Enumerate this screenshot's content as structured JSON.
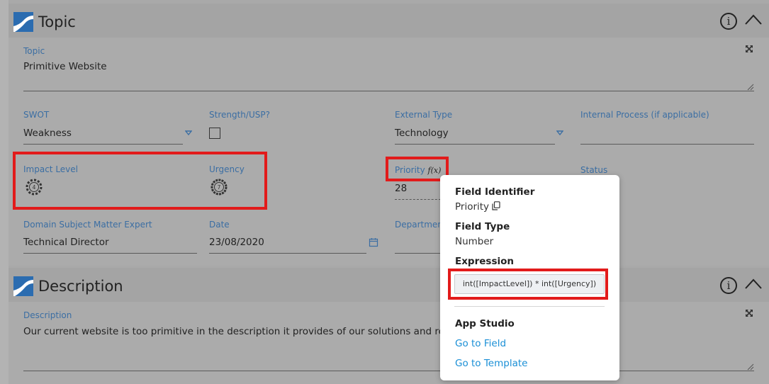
{
  "topic_section": {
    "title": "Topic",
    "fields": {
      "topic": {
        "label": "Topic",
        "value": "Primitive Website"
      },
      "swot": {
        "label": "SWOT",
        "value": "Weakness"
      },
      "strength": {
        "label": "Strength/USP?",
        "checked": false
      },
      "external_type": {
        "label": "External Type",
        "value": "Technology"
      },
      "internal_process": {
        "label": "Internal Process (if applicable)",
        "value": ""
      },
      "impact_level": {
        "label": "Impact Level",
        "value": "4"
      },
      "urgency": {
        "label": "Urgency",
        "value": "7"
      },
      "priority": {
        "label": "Priority",
        "formula_icon": "f(x)",
        "value": "28"
      },
      "status": {
        "label": "Status"
      },
      "domain_expert": {
        "label": "Domain Subject Matter Expert",
        "value": "Technical Director"
      },
      "date": {
        "label": "Date",
        "value": "23/08/2020"
      },
      "department": {
        "label": "Department"
      }
    }
  },
  "description_section": {
    "title": "Description",
    "fields": {
      "description": {
        "label": "Description",
        "value": "Our current website is too primitive in the description it provides of our solutions and requ"
      }
    }
  },
  "popup": {
    "field_identifier_heading": "Field Identifier",
    "field_identifier_value": "Priority",
    "field_type_heading": "Field Type",
    "field_type_value": "Number",
    "expression_heading": "Expression",
    "expression_value": "int([ImpactLevel]) * int([Urgency])",
    "app_studio_heading": "App Studio",
    "go_to_field": "Go to Field",
    "go_to_template": "Go to Template"
  },
  "icons": {
    "section_logo": "app-logo-icon",
    "info": "info-icon",
    "collapse": "chevron-up-icon",
    "expand": "expand-icon",
    "dropdown": "dropdown-arrow-icon",
    "calendar": "calendar-icon",
    "copy": "copy-icon",
    "rating": "rating-dial-icon"
  },
  "colors": {
    "label_blue": "#3b6ea3",
    "link_blue": "#1a8fd6",
    "highlight_red": "#e21b1b",
    "logo_blue": "#2b6cb0"
  }
}
